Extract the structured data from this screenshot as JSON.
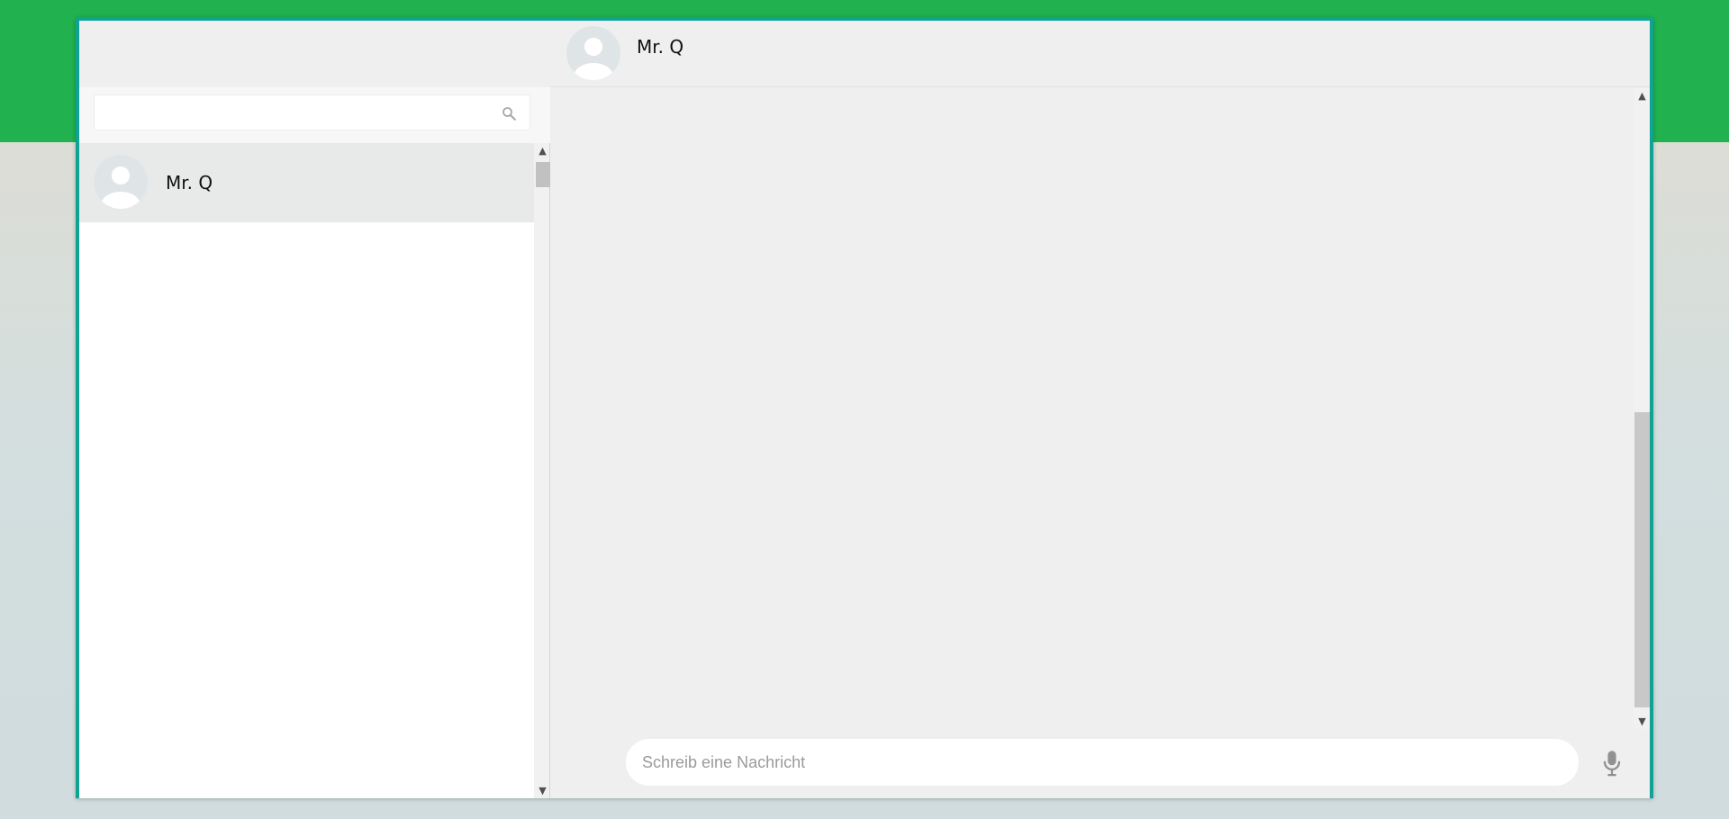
{
  "sidebar": {
    "search": {
      "value": "",
      "placeholder": ""
    },
    "chats": [
      {
        "name": "Mr. Q",
        "selected": true
      }
    ]
  },
  "conversation": {
    "contact_name": "Mr. Q"
  },
  "composer": {
    "placeholder": "Schreib eine Nachricht",
    "value": ""
  },
  "colors": {
    "brand_green": "#21b14e",
    "window_border": "#0fa394",
    "panel_bg": "#efefef",
    "selected_row": "#e8eaea"
  },
  "icons": {
    "search": "search-icon",
    "mic": "mic-icon",
    "avatar": "default-avatar-icon"
  }
}
